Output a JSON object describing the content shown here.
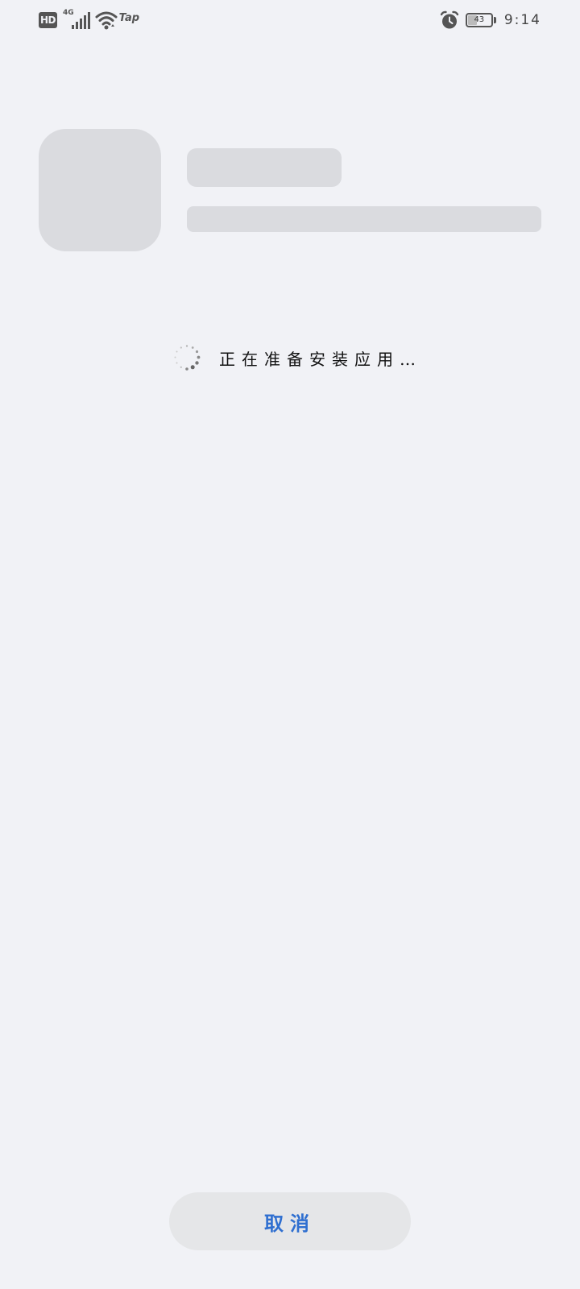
{
  "status_bar": {
    "hd_label": "HD",
    "network_type": "4G",
    "signal_icon": "cellular-signal-icon",
    "wifi_icon": "wifi-icon",
    "extra_label": "Tap",
    "alarm_icon": "alarm-clock-icon",
    "battery_level": "43",
    "time": "9:14"
  },
  "installer": {
    "loading_icon": "spinner-icon",
    "status_text": "正在准备安装应用…",
    "cancel_label": "取消"
  },
  "colors": {
    "background": "#f1f2f6",
    "placeholder": "#dadbdf",
    "button_bg": "#e5e6e8",
    "accent": "#2f6fd0"
  }
}
